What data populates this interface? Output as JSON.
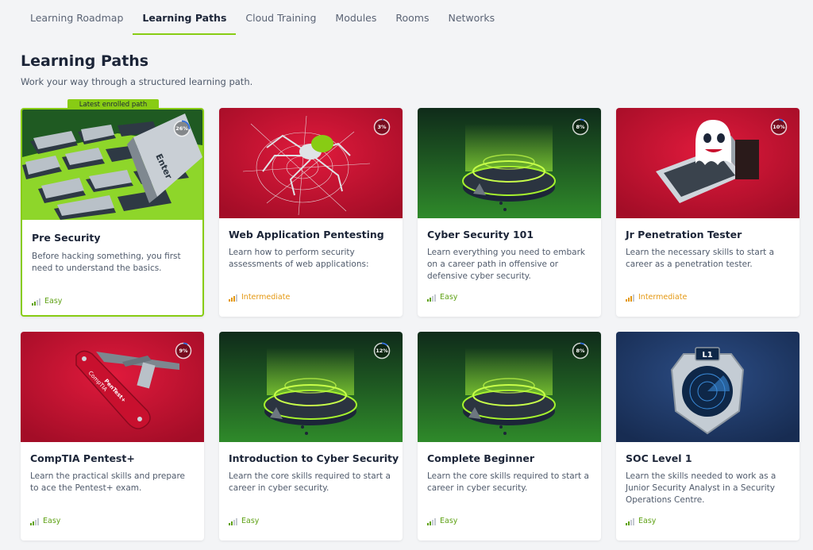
{
  "tabs": [
    {
      "label": "Learning Roadmap"
    },
    {
      "label": "Learning Paths"
    },
    {
      "label": "Cloud Training"
    },
    {
      "label": "Modules"
    },
    {
      "label": "Rooms"
    },
    {
      "label": "Networks"
    }
  ],
  "active_tab": "Learning Paths",
  "page": {
    "title": "Learning Paths",
    "subtitle": "Work your way through a structured learning path."
  },
  "colors": {
    "accent": "#88cc14",
    "easy": "#5ea114",
    "intermediate": "#e49812",
    "red_bg": "#c8102e",
    "green_bg": "#1e6b1e",
    "blue_bg": "#1f3a68"
  },
  "cards": [
    {
      "title": "Pre Security",
      "description": "Before hacking something, you first need to understand the basics.",
      "difficulty": "Easy",
      "progress_label": "26%",
      "progress": 0.26,
      "badge": "Latest enrolled path",
      "art_label": "Enter",
      "icon": "keyboard-icon"
    },
    {
      "title": "Web Application Pentesting",
      "description": "Learn how to perform security assessments of web applications:",
      "difficulty": "Intermediate",
      "progress_label": "3%",
      "progress": 0.03,
      "icon": "spider-icon"
    },
    {
      "title": "Cyber Security 101",
      "description": "Learn everything you need to embark on a career path in offensive or defensive cyber security.",
      "difficulty": "Easy",
      "progress_label": "8%",
      "progress": 0.08,
      "icon": "portal-icon"
    },
    {
      "title": "Jr Penetration Tester",
      "description": "Learn the necessary skills to start a career as a penetration tester.",
      "difficulty": "Intermediate",
      "progress_label": "10%",
      "progress": 0.1,
      "icon": "ghost-laptop-icon"
    },
    {
      "title": "CompTIA Pentest+",
      "description": "Learn the practical skills and prepare to ace the Pentest+ exam.",
      "difficulty": "Easy",
      "progress_label": "9%",
      "progress": 0.09,
      "art_label_1": "CompTIA",
      "art_label_2": "PenTest+",
      "icon": "swiss-knife-icon"
    },
    {
      "title": "Introduction to Cyber Security",
      "description": "Learn the core skills required to start a career in cyber security.",
      "difficulty": "Easy",
      "progress_label": "12%",
      "progress": 0.12,
      "icon": "portal-icon"
    },
    {
      "title": "Complete Beginner",
      "description": "Learn the core skills required to start a career in cyber security.",
      "difficulty": "Easy",
      "progress_label": "8%",
      "progress": 0.08,
      "icon": "portal-icon"
    },
    {
      "title": "SOC Level 1",
      "description": "Learn the skills needed to work as a Junior Security Analyst in a Security Operations Centre.",
      "difficulty": "Easy",
      "art_label": "L1",
      "icon": "shield-radar-icon"
    }
  ]
}
